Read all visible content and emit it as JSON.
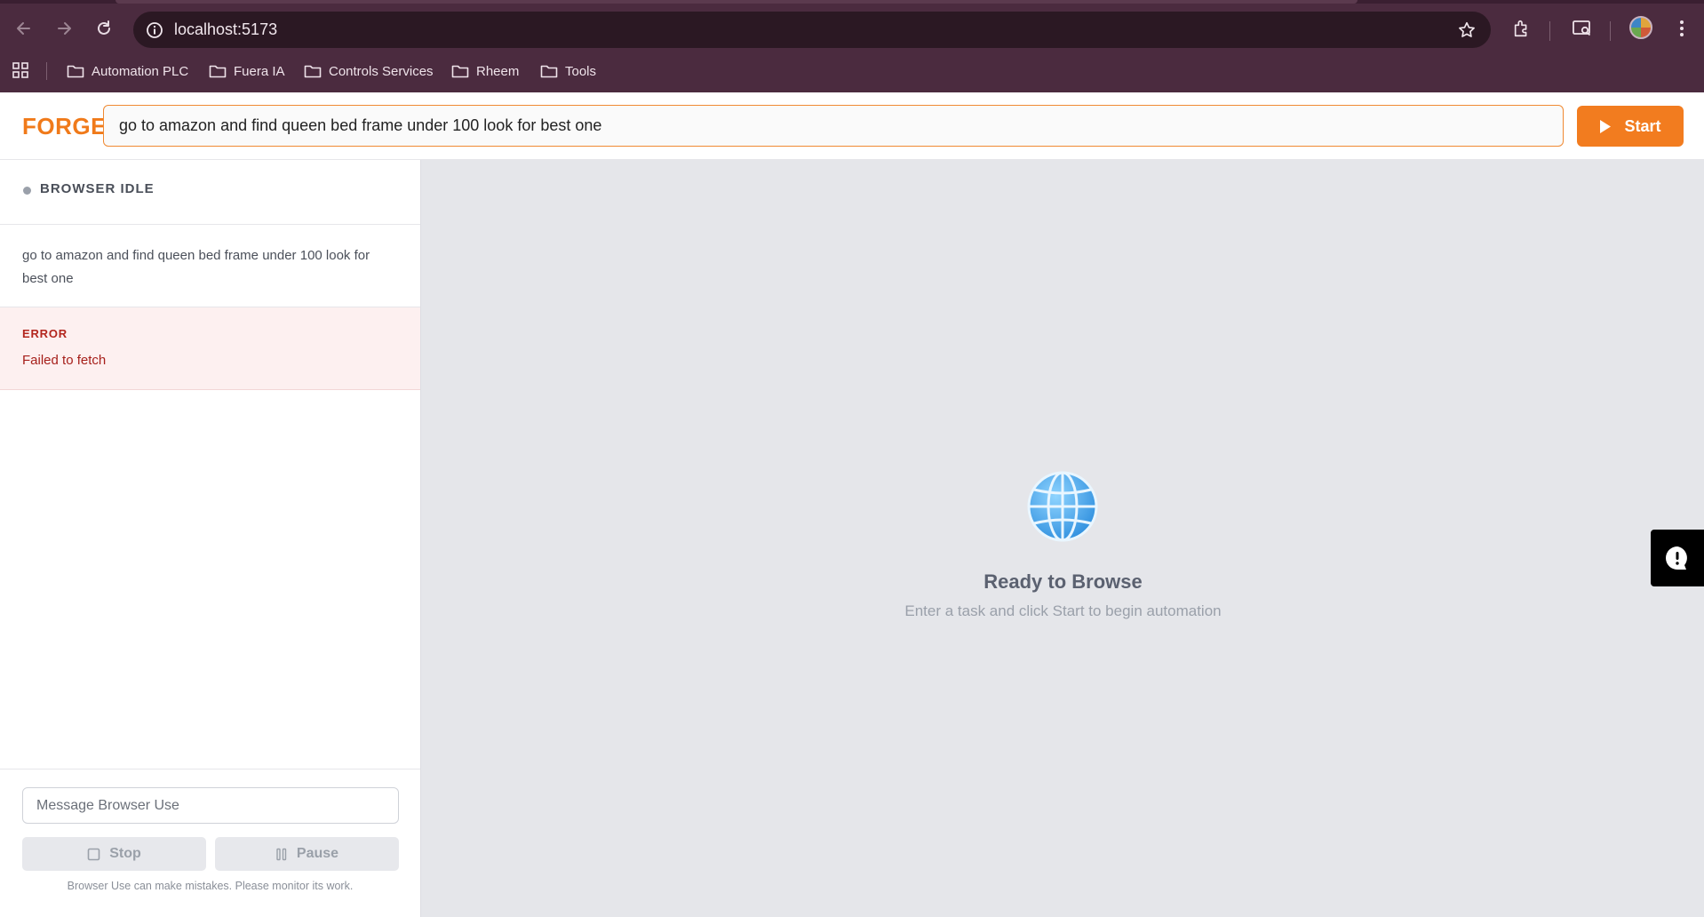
{
  "browser": {
    "url": "localhost:5173",
    "bookmarks": [
      {
        "label": "Automation PLC"
      },
      {
        "label": "Fuera IA"
      },
      {
        "label": "Controls Services"
      },
      {
        "label": "Rheem"
      },
      {
        "label": "Tools"
      }
    ]
  },
  "header": {
    "logo": "FORGE",
    "task_value": "go to amazon and find queen bed frame under 100 look for best one",
    "start_label": "Start",
    "accent_color": "#f27c1f"
  },
  "sidebar": {
    "status": "BROWSER IDLE",
    "task_message": "go to amazon and find queen bed frame under 100 look for best one",
    "error": {
      "title": "ERROR",
      "message": "Failed to fetch"
    },
    "message_placeholder": "Message Browser Use",
    "stop_label": "Stop",
    "pause_label": "Pause",
    "disclaimer": "Browser Use can make mistakes. Please monitor its work."
  },
  "viewport": {
    "icon": "globe-icon",
    "title": "Ready to Browse",
    "subtitle": "Enter a task and click Start to begin automation"
  }
}
